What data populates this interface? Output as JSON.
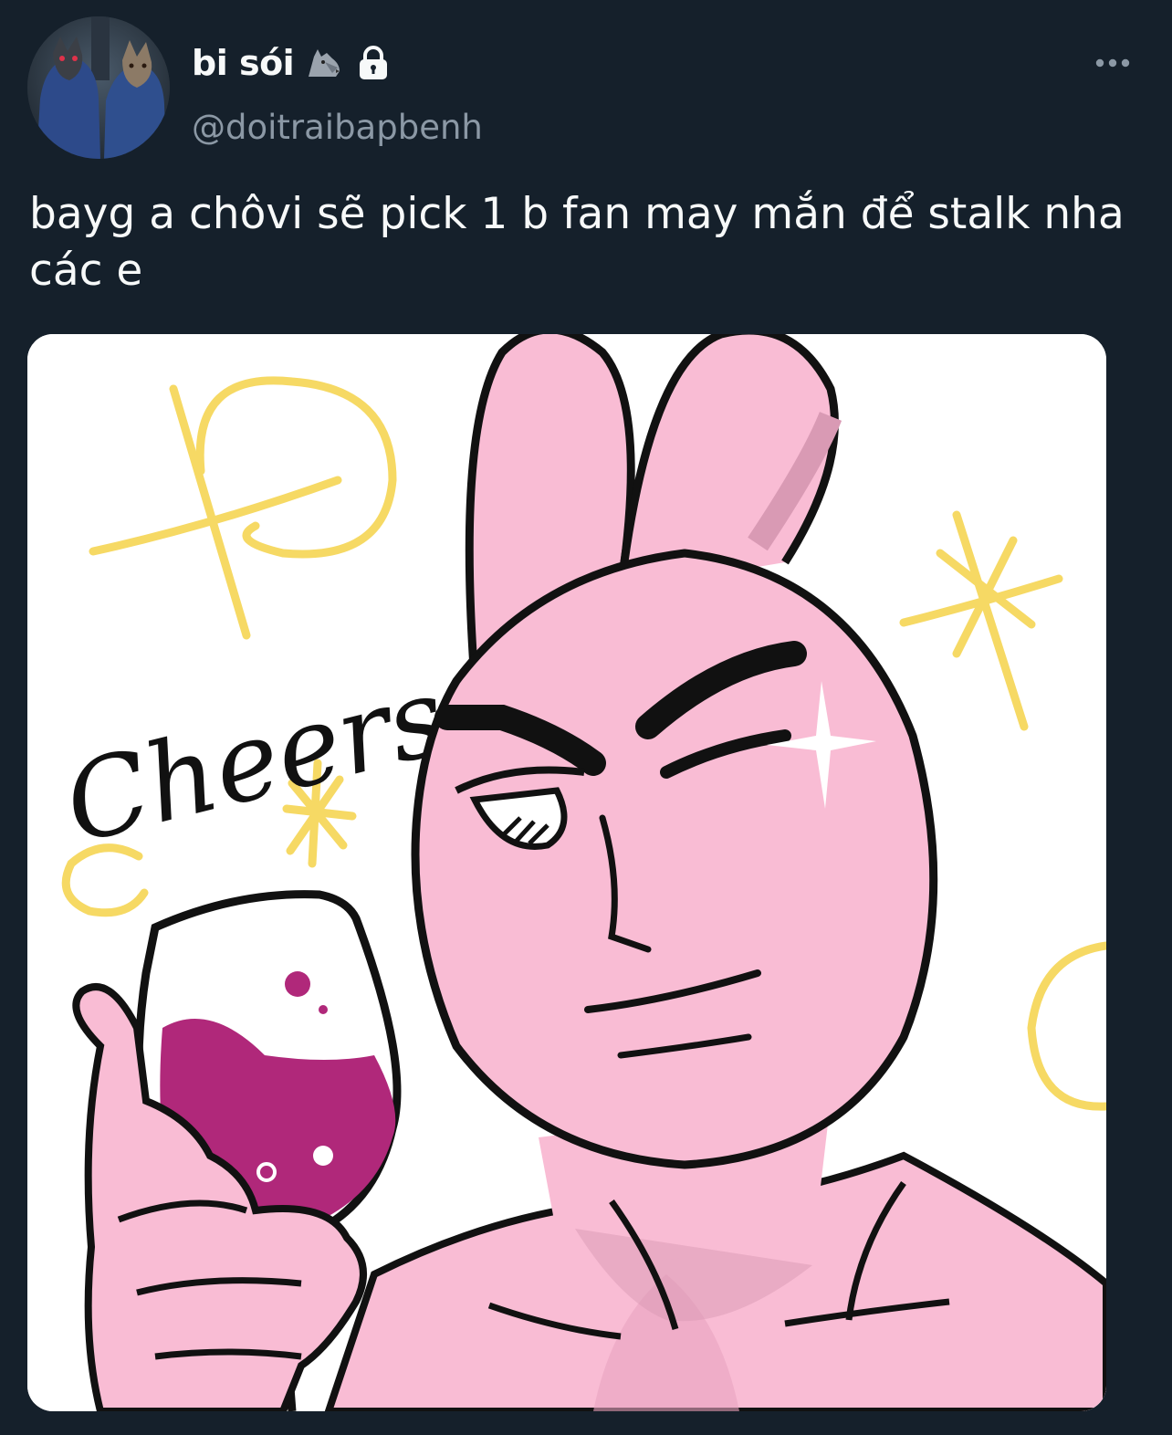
{
  "author": {
    "display_name": "bi sói",
    "handle": "@doitraibapbenh",
    "verified_badge": "wolf-emoji",
    "protected_icon": "lock-icon"
  },
  "tweet": {
    "text": "bayg a chôvi sẽ pick 1 b fan may mắn để stalk nha các e"
  },
  "media": {
    "caption_text": "Cheers"
  },
  "colors": {
    "background": "#15202b",
    "primary_text": "#f7f9f9",
    "secondary_text": "#8b98a5",
    "bunny_pink": "#f9bcd4",
    "wine": "#b0287a",
    "sparkle_yellow": "#f6d964"
  },
  "actions": {
    "more_icon": "more-horizontal-icon"
  }
}
